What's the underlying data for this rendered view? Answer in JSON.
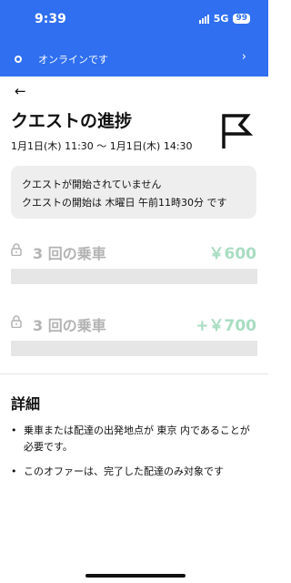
{
  "status_bar": {
    "time": "9:39",
    "network": "5G",
    "battery": "99"
  },
  "online_banner": {
    "text": "オンラインです",
    "chevron": "›"
  },
  "header": {
    "back_icon": "←",
    "title": "クエストの進捗",
    "date_range": "1月1日(木) 11:30 〜 1月1日(木) 14:30"
  },
  "notice": {
    "line1": "クエストが開始されていません",
    "line2": "クエストの開始は 木曜日 午前11時30分 です"
  },
  "quests": [
    {
      "label": "3 回の乗車",
      "reward": "￥600",
      "progress": 0
    },
    {
      "label": "3 回の乗車",
      "reward": "+￥700",
      "progress": 0
    }
  ],
  "details": {
    "title": "詳細",
    "items": [
      "乗車または配達の出発地点が 東京 内であることが必要です。",
      "このオファーは、完了した配達のみ対象です"
    ]
  },
  "colors": {
    "brand_blue": "#2f6ff0",
    "reward_green": "#a8ddc2",
    "muted_gray": "#b3b3b3"
  }
}
